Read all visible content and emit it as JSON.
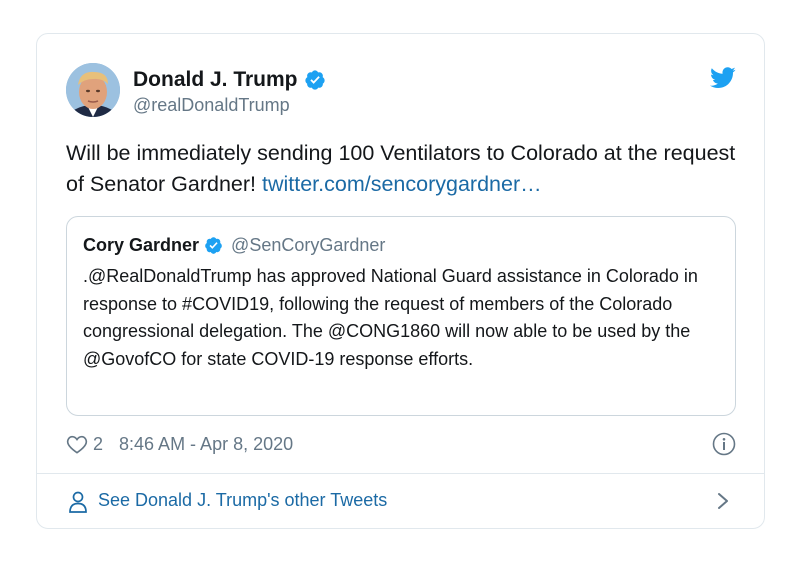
{
  "tweet": {
    "author": {
      "display_name": "Donald J. Trump",
      "handle": "@realDonaldTrump",
      "verified": true
    },
    "text": "Will be immediately sending 100 Ventilators to Colorado at the request of Senator Gardner! ",
    "link_text": "twitter.com/sencorygardner…",
    "quoted": {
      "display_name": "Cory Gardner",
      "handle": "@SenCoryGardner",
      "verified": true,
      "text": ".@RealDonaldTrump has approved National Guard assistance in Colorado in response to #COVID19, following the request of members of the Colorado congressional delegation. The @CONG1860 will now able to be used by the @GovofCO for state COVID-19 response efforts."
    },
    "like_count": "2",
    "timestamp": "8:46 AM - Apr 8, 2020"
  },
  "footer": {
    "label": "See Donald J. Trump's other Tweets"
  },
  "icons": {
    "verified": "verified-badge-icon",
    "twitter": "twitter-bird-icon",
    "like": "heart-icon",
    "info": "info-icon",
    "person": "person-icon",
    "chevron": "chevron-right-icon"
  },
  "colors": {
    "twitter_blue": "#1da1f2",
    "link": "#1b6aa5",
    "secondary_text": "#657786",
    "border": "#e1e8ed"
  }
}
